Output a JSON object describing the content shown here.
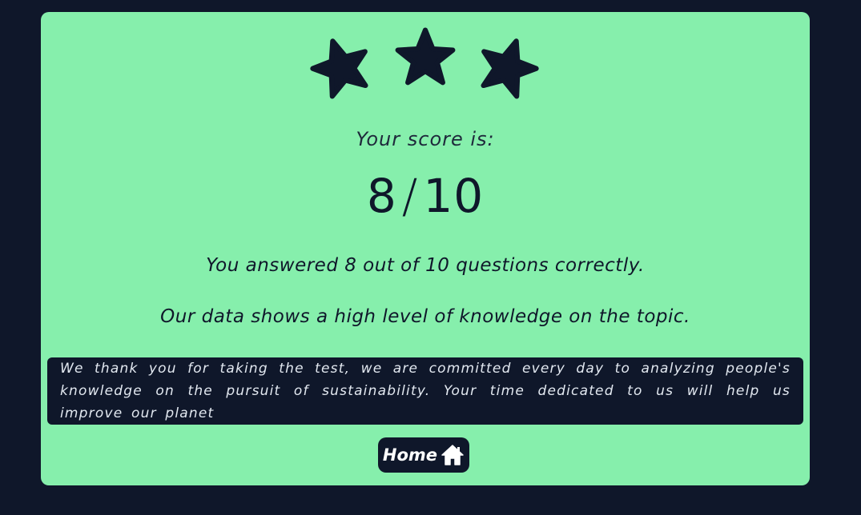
{
  "result": {
    "stars": {
      "earned": 3,
      "total": 3,
      "icon": "star-icon"
    },
    "score_label": "Your score is:",
    "score": 8,
    "score_separator": "/",
    "score_total": 10,
    "answered_text": "You answered 8 out of 10 questions correctly.",
    "knowledge_text": "Our data shows a high level of knowledge on the topic.",
    "thanks_text": "We thank you for taking the test, we are committed every day to analyzing people's knowledge on the pursuit of sustainability. Your time dedicated to us will help us improve our planet"
  },
  "home_button": {
    "label": "Home",
    "icon": "home-icon"
  },
  "colors": {
    "background": "#0f172a",
    "card": "#86efac",
    "text_dark": "#0f172a",
    "text_light": "#e2e8f0"
  }
}
